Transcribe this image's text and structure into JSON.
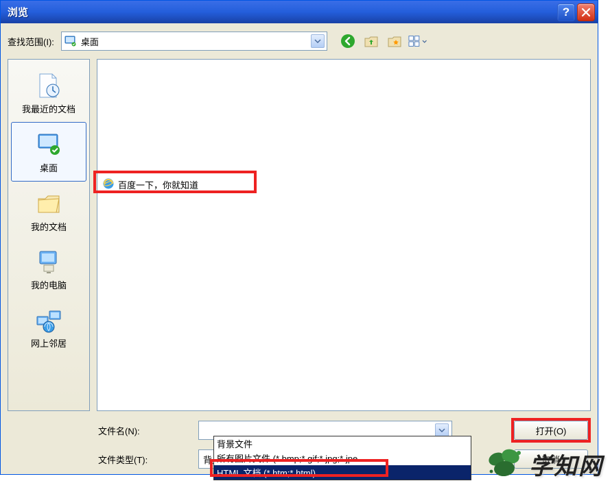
{
  "window": {
    "title": "浏览"
  },
  "toprow": {
    "label": "查找范围(I):",
    "combo_value": "桌面"
  },
  "places": [
    {
      "label": "我最近的文档"
    },
    {
      "label": "桌面"
    },
    {
      "label": "我的文档"
    },
    {
      "label": "我的电脑"
    },
    {
      "label": "网上邻居"
    }
  ],
  "file_list": {
    "items": [
      {
        "name": "百度一下，你就知道"
      }
    ]
  },
  "filename": {
    "label": "文件名(N):",
    "value": ""
  },
  "filetype": {
    "label": "文件类型(T):",
    "value": "背景文件",
    "options": [
      "背景文件",
      "所有图片文件 (*.bmp;*.gif;*.jpg;*.jpe...",
      "HTML 文档 (*.htm;*.html)"
    ]
  },
  "buttons": {
    "open": "打开(O)",
    "cancel": "取消"
  },
  "watermark": {
    "text": "学知网"
  }
}
